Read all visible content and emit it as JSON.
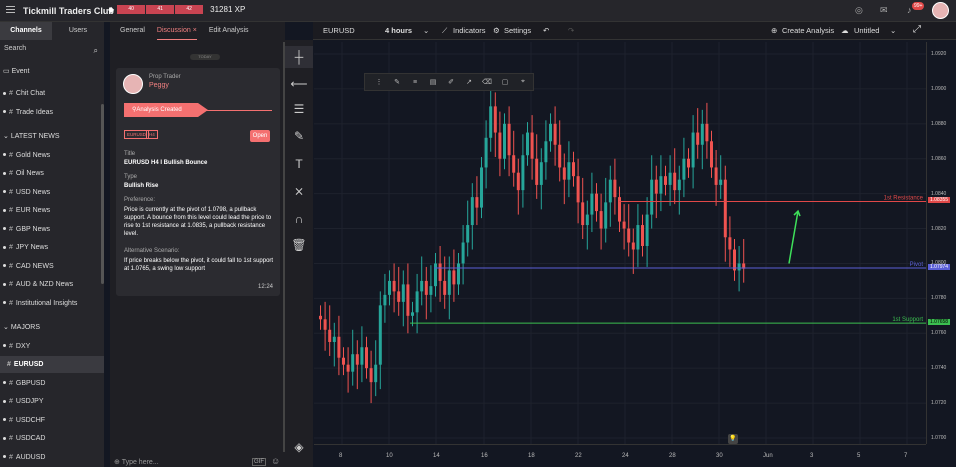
{
  "app": {
    "title": "Tickmill Traders Club",
    "xp_segments": [
      "40",
      "41",
      "42"
    ],
    "xp": "31281 XP",
    "notif_badge": "99+"
  },
  "sidebar": {
    "tabs": [
      "Channels",
      "Users"
    ],
    "search_placeholder": "Search",
    "event": "Event",
    "items_top": [
      "Chit Chat",
      "Trade Ideas"
    ],
    "section_news": "LATEST NEWS",
    "news": [
      "Gold News",
      "Oil News",
      "USD News",
      "EUR News",
      "GBP News",
      "JPY News",
      "CAD NEWS",
      "AUD & NZD News",
      "Institutional Insights"
    ],
    "section_majors": "MAJORS",
    "majors": [
      "DXY",
      "EURUSD",
      "GBPUSD",
      "USDJPY",
      "USDCHF",
      "USDCAD",
      "AUDUSD"
    ]
  },
  "panel": {
    "tabs": [
      "General",
      "Discussion",
      "Edit Analysis"
    ],
    "close_glyph": "×",
    "today": "TODAY",
    "role": "Prop Trader",
    "author": "Peggy",
    "status": "Analysis Created",
    "tags": [
      "EURUSD",
      "H4"
    ],
    "open": "Open",
    "title_label": "Title",
    "title": "EURUSD H4 I Bullish Bounce",
    "type_label": "Type",
    "type": "Bullish Rise",
    "pref_label": "Preference:",
    "pref": "Price is currently at the pivot of 1.0798, a pullback support. A bounce from this  level could lead the price to rise to 1st resistance at  1.0835,  a pullback resistance level.",
    "alt_label": "Alternative Scenario:",
    "alt": "If price breaks below the pivot, it could fall to 1st support at 1.0765, a swing low support",
    "time": "12:24",
    "input_placeholder": "Type here...",
    "gif": "GIF"
  },
  "chartbar": {
    "symbol": "EURUSD",
    "interval": "4 hours",
    "indicators": "Indicators",
    "settings": "Settings",
    "create": "Create Analysis",
    "untitled": "Untitled"
  },
  "chart_data": {
    "type": "candlestick",
    "symbol": "EURUSD",
    "interval": "4 hours",
    "yticks": [
      "1.0920",
      "1.0900",
      "1.0880",
      "1.0860",
      "1.0840",
      "1.0820",
      "1.0800",
      "1.0780",
      "1.0760",
      "1.0740",
      "1.0720",
      "1.0700"
    ],
    "xticks": [
      "8",
      "10",
      "14",
      "16",
      "18",
      "22",
      "24",
      "28",
      "30",
      "Jun",
      "3",
      "5",
      "7"
    ],
    "levels": [
      {
        "name": "1st Resistance",
        "value": "1.08355",
        "color": "#e04848"
      },
      {
        "name": "Pivot",
        "value": "1.07974",
        "color": "#5b5fd6"
      },
      {
        "name": "1st Support",
        "value": "1.07658",
        "color": "#3bbf50"
      }
    ],
    "ylim": [
      1.0695,
      1.0925
    ],
    "closes": [
      1.0768,
      1.0762,
      1.0755,
      1.0758,
      1.0746,
      1.0742,
      1.0738,
      1.0748,
      1.0742,
      1.0752,
      1.074,
      1.0732,
      1.0742,
      1.0776,
      1.0782,
      1.079,
      1.0784,
      1.0778,
      1.0788,
      1.077,
      1.0772,
      1.0784,
      1.079,
      1.0782,
      1.0787,
      1.08,
      1.079,
      1.0782,
      1.0796,
      1.0788,
      1.08,
      1.0812,
      1.0822,
      1.0838,
      1.0832,
      1.0855,
      1.0872,
      1.089,
      1.0875,
      1.086,
      1.088,
      1.0862,
      1.0852,
      1.0842,
      1.0862,
      1.0875,
      1.086,
      1.0845,
      1.0858,
      1.087,
      1.088,
      1.0868,
      1.0855,
      1.0848,
      1.0858,
      1.085,
      1.0835,
      1.0822,
      1.0828,
      1.084,
      1.083,
      1.082,
      1.0835,
      1.0848,
      1.0838,
      1.0824,
      1.082,
      1.0812,
      1.0808,
      1.0822,
      1.081,
      1.0828,
      1.0848,
      1.084,
      1.085,
      1.0845,
      1.0852,
      1.0842,
      1.0848,
      1.086,
      1.0855,
      1.0875,
      1.0868,
      1.088,
      1.087,
      1.0855,
      1.0845,
      1.0848,
      1.0815,
      1.0808,
      1.0796,
      1.08,
      1.0797
    ],
    "arrow": {
      "from": [
        1.08,
        1.08
      ],
      "to": [
        1.083,
        1.083
      ]
    }
  }
}
